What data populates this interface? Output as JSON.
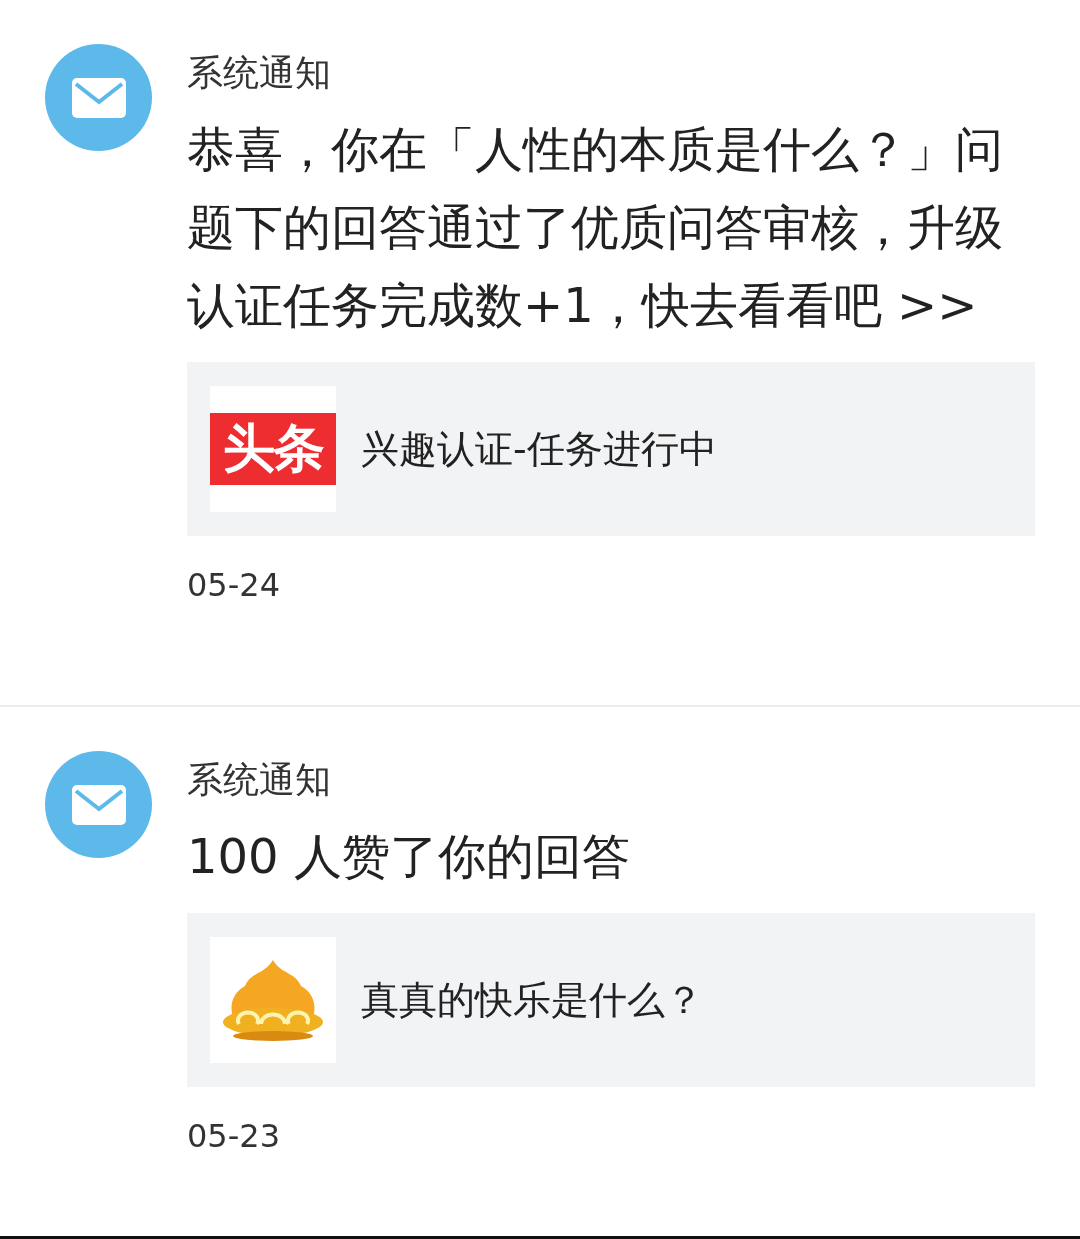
{
  "notifications": [
    {
      "title": "系统通知",
      "message": "恭喜，你在「人性的本质是什么？」问题下的回答通过了优质问答审核，升级认证任务完成数+1，快去看看吧 >>",
      "card": {
        "kind": "text-logo",
        "logo_text": "头条",
        "text": "兴趣认证-任务进行中"
      },
      "date": "05-24"
    },
    {
      "title": "系统通知",
      "message": "100 人赞了你的回答",
      "card": {
        "kind": "emblem",
        "text": "真真的快乐是什么？"
      },
      "date": "05-23"
    }
  ]
}
